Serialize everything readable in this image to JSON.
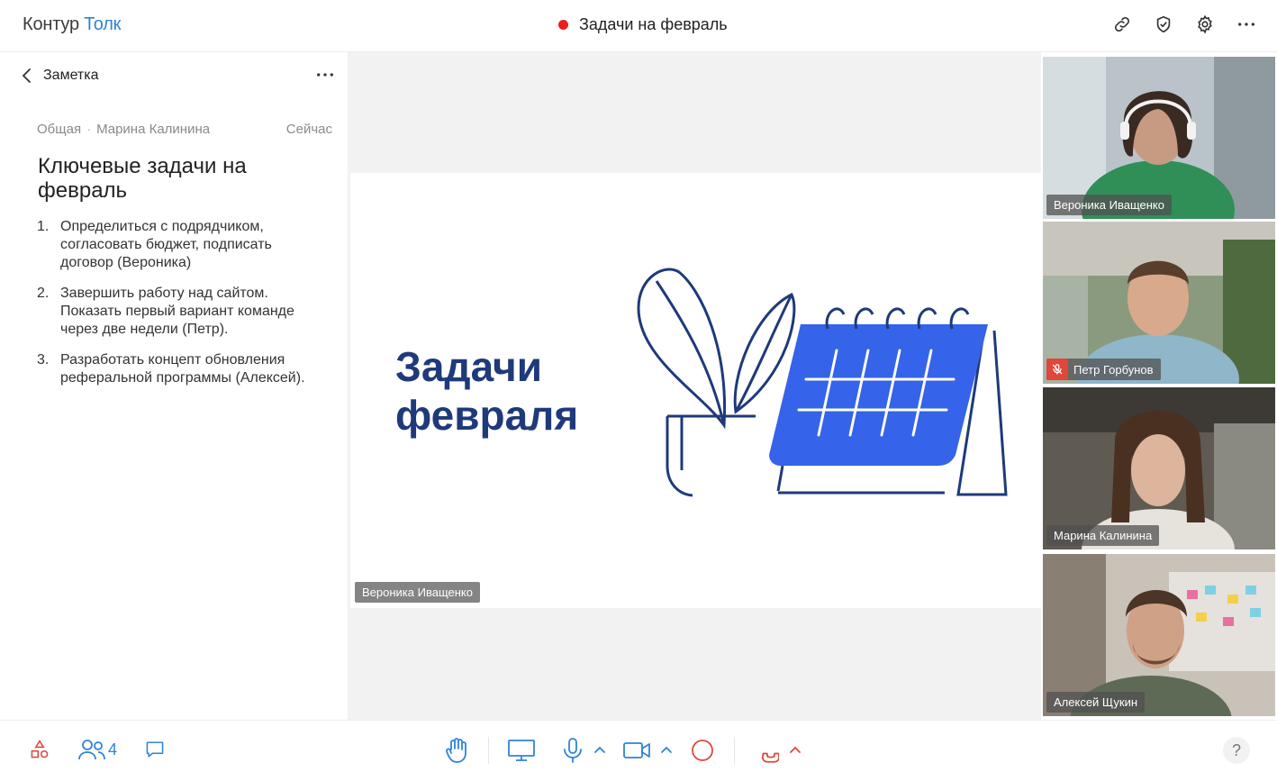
{
  "header": {
    "brand": "Контур",
    "product": "Толк",
    "meeting_title": "Задачи на февраль",
    "icons": [
      "link-icon",
      "shield-check-icon",
      "gear-icon",
      "more-horizontal-icon"
    ]
  },
  "note": {
    "header_title": "Заметка",
    "category": "Общая",
    "author": "Марина Калинина",
    "time": "Сейчас",
    "title": "Ключевые задачи на февраль",
    "items": [
      {
        "num": "1.",
        "text": "Определиться с подрядчиком, согласовать бюджет, подписать договор (Вероника)"
      },
      {
        "num": "2.",
        "text": "Завершить работу над сайтом. Показать первый вариант команде через две недели (Петр)."
      },
      {
        "num": "3.",
        "text": "Разработать концепт обновления реферальной программы (Алексей)."
      }
    ]
  },
  "slide": {
    "title_line1": "Задачи",
    "title_line2": "февраля",
    "presenter": "Вероника Иващенко"
  },
  "participants": [
    {
      "name": "Вероника Иващенко",
      "active": true,
      "muted": false
    },
    {
      "name": "Петр Горбунов",
      "active": false,
      "muted": true
    },
    {
      "name": "Марина Калинина",
      "active": false,
      "muted": false
    },
    {
      "name": "Алексей Щукин",
      "active": false,
      "muted": false
    }
  ],
  "toolbar": {
    "participants_count": "4",
    "help": "?"
  },
  "colors": {
    "accent": "#2f83d9",
    "danger": "#e0463a",
    "slide_navy": "#1f3a7a",
    "calendar_blue": "#3563e9"
  }
}
